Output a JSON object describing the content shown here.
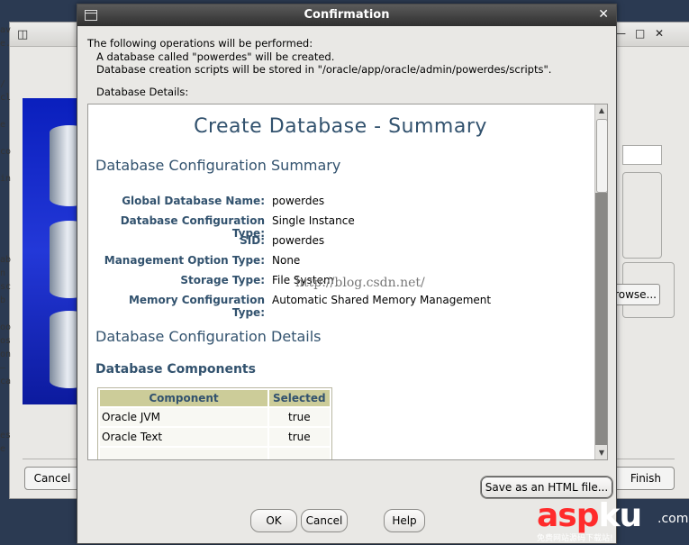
{
  "background_window": {
    "controls": {
      "minimize": "—",
      "maximize": "□",
      "close": "✕"
    },
    "left_strip_text": [
      "av",
      "e.",
      "",
      "",
      "/",
      "cl",
      "",
      "e",
      "",
      "co",
      "",
      "in",
      "",
      "",
      "",
      "",
      "",
      "ab",
      "n",
      "sc",
      "b",
      "",
      "oo",
      "os",
      "on",
      "–",
      "ca",
      "",
      "",
      "",
      "es",
      "e"
    ],
    "browse_label": "rowse...",
    "cancel_label": "Cancel",
    "finish_label": "Finish"
  },
  "dialog": {
    "title": "Confirmation",
    "close_glyph": "✕",
    "intro_lines": [
      "The following operations will be performed:",
      "A database called \"powerdes\" will be created.",
      "Database creation scripts will be stored in \"/oracle/app/oracle/admin/powerdes/scripts\"."
    ],
    "details_label": "Database Details:",
    "summary": {
      "title": "Create Database - Summary",
      "config_summary_heading": "Database Configuration Summary",
      "fields": [
        {
          "label": "Global Database Name:",
          "value": "powerdes"
        },
        {
          "label": "Database Configuration Type:",
          "value": "Single Instance"
        },
        {
          "label": "SID:",
          "value": "powerdes"
        },
        {
          "label": "Management Option Type:",
          "value": "None"
        },
        {
          "label": "Storage Type:",
          "value": "File System"
        },
        {
          "label": "Memory Configuration Type:",
          "value": "Automatic Shared Memory Management"
        }
      ],
      "watermark": "http://blog.csdn.net/",
      "config_details_heading": "Database Configuration Details",
      "components_heading": "Database Components",
      "components_table": {
        "headers": [
          "Component",
          "Selected"
        ],
        "rows": [
          [
            "Oracle JVM",
            "true"
          ],
          [
            "Oracle Text",
            "true"
          ],
          [
            "",
            ""
          ]
        ]
      }
    },
    "buttons": {
      "save_html": "Save as an HTML file...",
      "ok": "OK",
      "cancel": "Cancel",
      "help": "Help"
    }
  },
  "logo": {
    "brand_part1": "asp",
    "brand_part2": "ku",
    "domain_suffix": ".com",
    "tagline": "免费网站源码下载站!"
  }
}
